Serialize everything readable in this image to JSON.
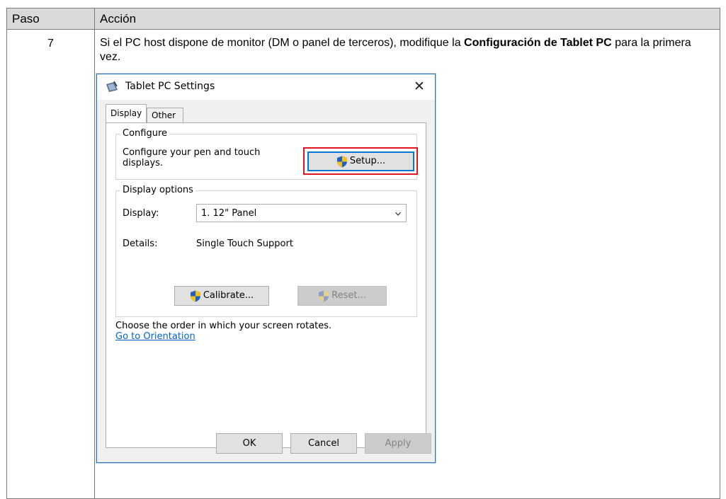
{
  "table": {
    "headers": {
      "step": "Paso",
      "action": "Acción"
    },
    "row": {
      "step": "7",
      "instruction_pre": "Si el PC host dispone de monitor (DM o panel de terceros), modifique la ",
      "instruction_bold1": "Configuración de Tablet PC",
      "instruction_post": " para la primera vez."
    }
  },
  "dialog": {
    "title": "Tablet PC Settings",
    "close_glyph": "✕",
    "tabs": [
      {
        "label": "Display",
        "active": true
      },
      {
        "label": "Other",
        "active": false
      }
    ],
    "configure": {
      "legend": "Configure",
      "text": "Configure your pen and touch displays.",
      "setup_label": "Setup..."
    },
    "display_options": {
      "legend": "Display options",
      "display_label": "Display:",
      "display_value": "1. 12\" Panel",
      "details_label": "Details:",
      "details_value": "Single Touch Support",
      "calibrate_label": "Calibrate...",
      "reset_label": "Reset..."
    },
    "orientation": {
      "text": "Choose the order in which your screen rotates.",
      "link": "Go to Orientation"
    },
    "footer": {
      "ok": "OK",
      "cancel": "Cancel",
      "apply": "Apply"
    }
  },
  "colors": {
    "highlight": "#e0161e",
    "link": "#0066cc",
    "accent": "#0078d7"
  },
  "icons": [
    "tablet-pc-icon",
    "close-icon",
    "uac-shield-icon",
    "chevron-down-icon"
  ]
}
